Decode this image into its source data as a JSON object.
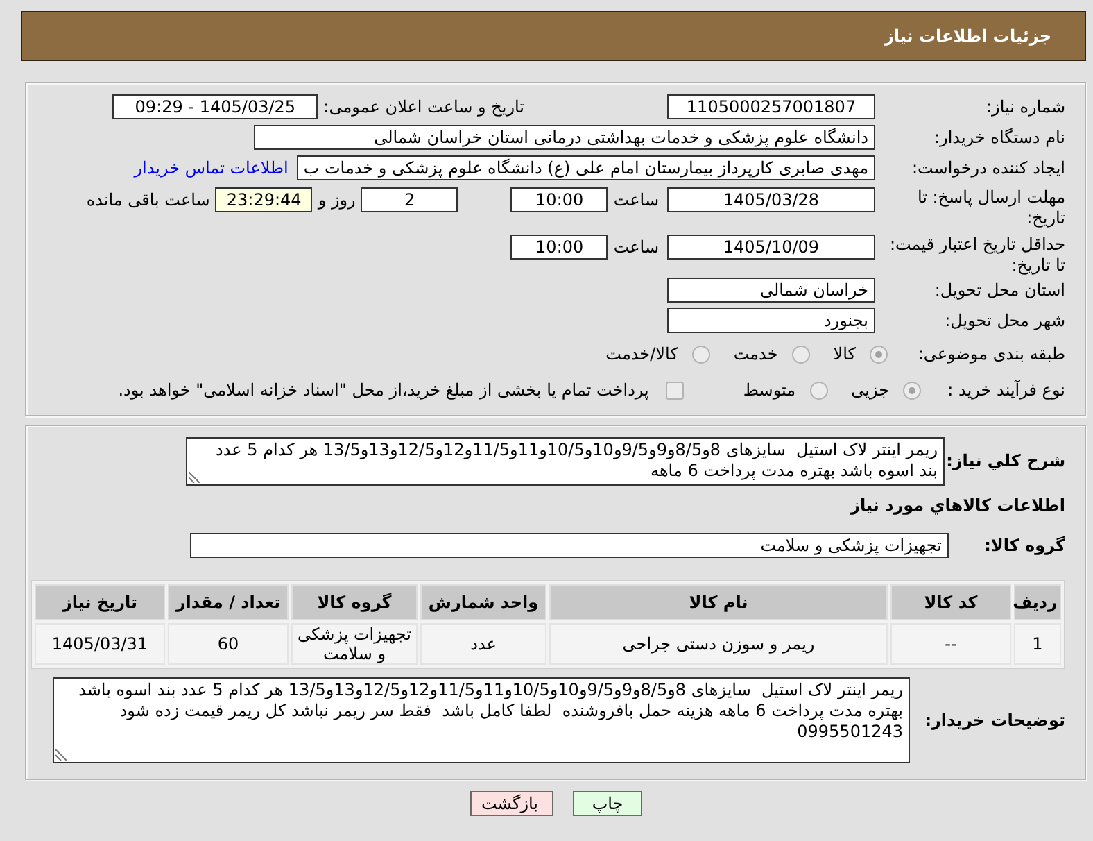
{
  "header": {
    "title": "جزئیات اطلاعات نیاز"
  },
  "summary": {
    "need_number": {
      "label": "شماره نیاز:",
      "value": "1105000257001807"
    },
    "announcement": {
      "label": "تاریخ و ساعت اعلان عمومی:",
      "value": "1405/03/25 - 09:29"
    },
    "buyer_org": {
      "label": "نام دستگاه خریدار:",
      "value": "دانشگاه علوم پزشکی و خدمات بهداشتی درمانی استان خراسان شمالی"
    },
    "requester": {
      "label": "ایجاد کننده درخواست:",
      "value": "مهدی صابری کارپرداز بیمارستان امام علی (ع) دانشگاه علوم پزشکی و خدمات ب",
      "contact_link": "اطلاعات تماس خریدار"
    },
    "reply_deadline": {
      "label": "مهلت ارسال پاسخ: تا تاریخ:",
      "date": "1405/03/28",
      "time_label": "ساعت",
      "time": "10:00",
      "days": "2",
      "days_label": "روز و",
      "remaining": "23:29:44",
      "remaining_label": "ساعت باقی مانده"
    },
    "price_validity": {
      "label": "حداقل تاریخ اعتبار قیمت: تا تاریخ:",
      "date": "1405/10/09",
      "time_label": "ساعت",
      "time": "10:00"
    },
    "delivery_province": {
      "label": "استان محل تحویل:",
      "value": "خراسان شمالی"
    },
    "delivery_city": {
      "label": "شهر محل تحویل:",
      "value": "بجنورد"
    },
    "category": {
      "label": "طبقه بندی موضوعی:",
      "options": [
        {
          "label": "کالا",
          "selected": true,
          "disabled": true
        },
        {
          "label": "خدمت",
          "selected": false,
          "disabled": true
        },
        {
          "label": "کالا/خدمت",
          "selected": false,
          "disabled": true
        }
      ]
    },
    "purchase_process": {
      "label": "نوع فرآیند خرید :",
      "options": [
        {
          "label": "جزیی",
          "selected": true,
          "disabled": true
        },
        {
          "label": "متوسط",
          "selected": false,
          "disabled": true
        }
      ],
      "treasury_option": {
        "label": "پرداخت تمام یا بخشی از مبلغ خرید،از محل \"اسناد خزانه اسلامی\" خواهد بود.",
        "checked": false,
        "disabled": true
      }
    }
  },
  "details": {
    "description": {
      "label": "شرح کلي نياز:",
      "value": "ریمر اینتر لاک استیل  سایزهای 8و8/5و9و9/5و10و10/5و11و11/5و12و12/5و13و13/5 هر کدام 5 عدد بند اسوه باشد بهتره مدت پرداخت 6 ماهه"
    },
    "items_heading": "اطلاعات کالاهاي مورد نياز",
    "goods_group": {
      "label": "گروه کالا:",
      "value": "تجهیزات پزشکی و سلامت"
    },
    "table": {
      "columns": [
        "ردیف",
        "کد کالا",
        "نام کالا",
        "واحد شمارش",
        "گروه کالا",
        "تعداد / مقدار",
        "تاریخ نیاز"
      ],
      "rows": [
        [
          "1",
          "--",
          "ریمر و سوزن دستی جراحی",
          "عدد",
          "تجهیزات پزشکی و سلامت",
          "60",
          "1405/03/31"
        ]
      ]
    },
    "buyer_notes": {
      "label": "توضیحات خریدار:",
      "value": "ریمر اینتر لاک استیل  سایزهای 8و8/5و9و9/5و10و10/5و11و11/5و12و12/5و13و13/5 هر کدام 5 عدد بند اسوه باشد بهتره مدت پرداخت 6 ماهه هزینه حمل بافروشنده  لطفا کامل باشد  فقط سر ریمر نباشد کل ریمر قیمت زده شود 0995501243"
    }
  },
  "buttons": [
    {
      "label": "چاپ",
      "kind": "print"
    },
    {
      "label": "بازگشت",
      "kind": "back"
    }
  ]
}
